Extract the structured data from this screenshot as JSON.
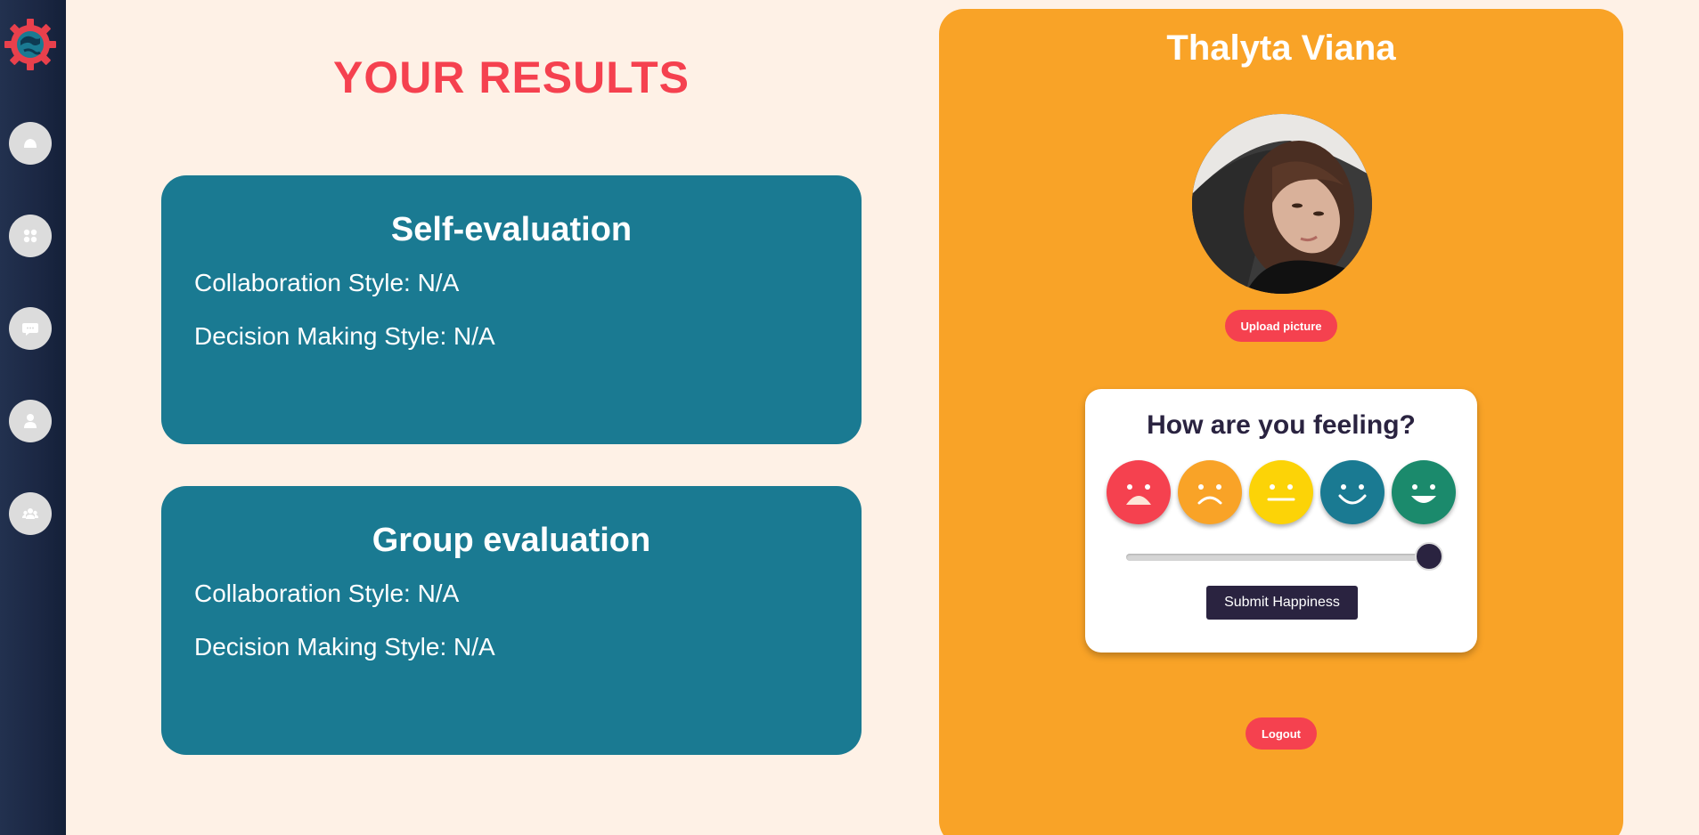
{
  "header": {
    "title": "YOUR RESULTS"
  },
  "sidebar": {
    "items": [
      {
        "name": "home",
        "icon": "home-icon"
      },
      {
        "name": "dashboard",
        "icon": "grid-icon"
      },
      {
        "name": "chat",
        "icon": "chat-icon"
      },
      {
        "name": "profile",
        "icon": "user-icon"
      },
      {
        "name": "team",
        "icon": "team-icon"
      }
    ]
  },
  "self_eval": {
    "title": "Self-evaluation",
    "collaboration": "Collaboration Style: N/A",
    "decision": "Decision Making Style: N/A"
  },
  "group_eval": {
    "title": "Group evaluation",
    "collaboration": "Collaboration Style: N/A",
    "decision": "Decision Making Style: N/A"
  },
  "profile": {
    "name": "Thalyta Viana",
    "upload_label": "Upload picture",
    "logout_label": "Logout"
  },
  "feeling": {
    "title": "How are you feeling?",
    "faces": [
      {
        "mood": "very-sad",
        "color": "#f5414f"
      },
      {
        "mood": "sad",
        "color": "#f9a327"
      },
      {
        "mood": "neutral",
        "color": "#fcd307"
      },
      {
        "mood": "happy",
        "color": "#1a7a92"
      },
      {
        "mood": "very-happy",
        "color": "#1b8a6c"
      }
    ],
    "slider_value": 1.0,
    "submit_label": "Submit Happiness"
  },
  "colors": {
    "accent_red": "#f5414f",
    "teal": "#1a7a92",
    "orange": "#f9a327",
    "navy": "#2a2340",
    "background": "#fef1e6"
  }
}
